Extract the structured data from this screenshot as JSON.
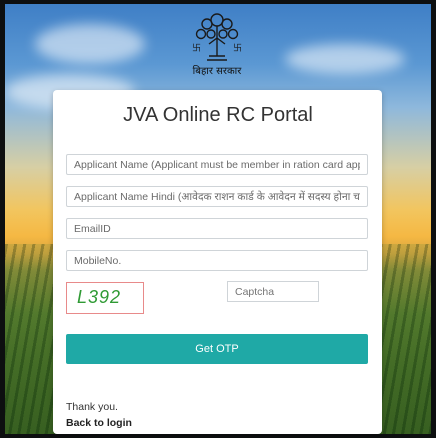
{
  "header": {
    "emblem_caption": "बिहार सरकार",
    "emblem_icon": "bihar-bodhi-tree-emblem-icon"
  },
  "form": {
    "title": "JVA Online RC Portal",
    "applicant_name_placeholder": "Applicant Name (Applicant must be member in ration card application)",
    "applicant_name_hindi_placeholder": "Applicant Name Hindi (आवेदक राशन कार्ड के आवेदन में सदस्य होना चाहिए)",
    "email_placeholder": "EmailID",
    "mobile_placeholder": "MobileNo.",
    "captcha_code": "L392",
    "captcha_placeholder": "Captcha",
    "otp_button_label": "Get OTP",
    "thanks_text": "Thank you.",
    "back_link_label": "Back to login"
  },
  "colors": {
    "accent": "#1fa9a6",
    "captcha_text": "#2f9a34",
    "captcha_border": "#e88a8a"
  }
}
